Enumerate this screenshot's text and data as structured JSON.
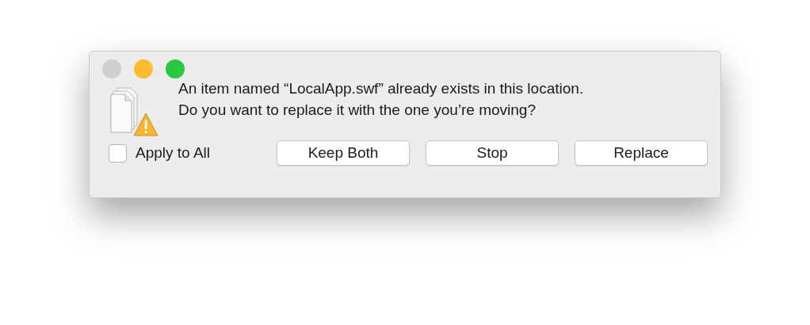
{
  "window": {
    "traffic_lights": [
      {
        "color": "#cfcfcf"
      },
      {
        "color": "#febc2e"
      },
      {
        "color": "#28c840"
      }
    ]
  },
  "message": [
    "An item named “LocalApp.swf” already exists in this location.",
    "Do you want to replace it with the one you’re moving?"
  ],
  "apply_to_all": {
    "label": "Apply to All",
    "checked": false
  },
  "buttons": [
    {
      "label": "Keep Both"
    },
    {
      "label": "Stop"
    },
    {
      "label": "Replace"
    }
  ]
}
